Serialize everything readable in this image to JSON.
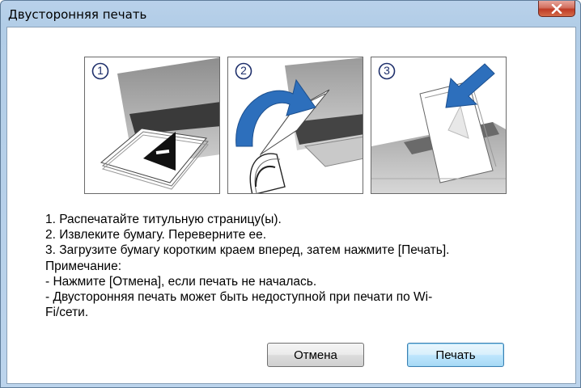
{
  "window": {
    "title": "Двусторонняя печать"
  },
  "steps": {
    "step1_num": "1",
    "step2_num": "2",
    "step3_num": "3"
  },
  "instructions": [
    "1. Распечатайте титульную страницу(ы).",
    "2. Извлеките бумагу. Переверните ее.",
    "3. Загрузите бумагу коротким краем вперед, затем нажмите [Печать].",
    "Примечание:",
    "- Нажмите [Отмена], если печать не началась.",
    "- Двусторонняя печать может быть недоступной при печати по Wi-",
    "Fi/сети."
  ],
  "buttons": {
    "cancel": "Отмена",
    "print": "Печать"
  },
  "icons": {
    "close": "close-icon",
    "arrow_flip": "curved-arrow-icon",
    "arrow_load": "down-arrow-icon"
  },
  "colors": {
    "accent_arrow": "#1f5fa8",
    "default_button_border": "#3c7fb1"
  }
}
